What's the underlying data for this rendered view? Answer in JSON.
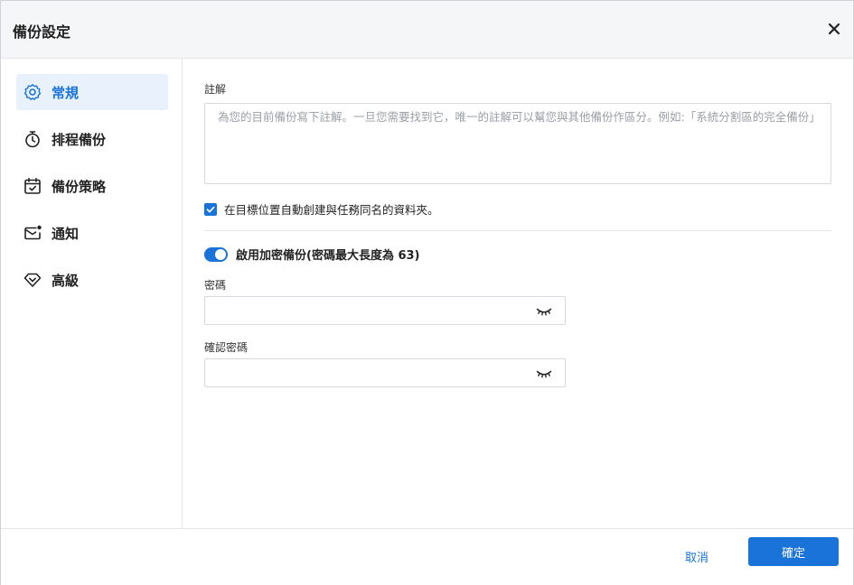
{
  "dialog": {
    "title": "備份設定",
    "close_icon": "close-icon"
  },
  "sidebar": {
    "items": [
      {
        "label": "常規",
        "icon": "gear-icon",
        "active": true
      },
      {
        "label": "排程備份",
        "icon": "stopwatch-icon",
        "active": false
      },
      {
        "label": "備份策略",
        "icon": "calendar-check-icon",
        "active": false
      },
      {
        "label": "通知",
        "icon": "mail-notification-icon",
        "active": false
      },
      {
        "label": "高級",
        "icon": "diamond-icon",
        "active": false
      }
    ]
  },
  "general": {
    "note_label": "註解",
    "note_placeholder": "為您的目前備份寫下註解。一旦您需要找到它，唯一的註解可以幫您與其他備份作區分。例如:「系統分割區的完全備份」",
    "create_folder_label": "在目標位置自動創建與任務同名的資料夾。",
    "create_folder_checked": true,
    "encryption_label": "啟用加密備份(密碼最大長度為 63)",
    "encryption_enabled": true,
    "password_label": "密碼",
    "password_value": "",
    "confirm_label": "確認密碼",
    "confirm_value": ""
  },
  "footer": {
    "cancel_label": "取消",
    "ok_label": "確定"
  },
  "colors": {
    "accent": "#1a73d9",
    "active_bg": "#e8f1fc"
  }
}
